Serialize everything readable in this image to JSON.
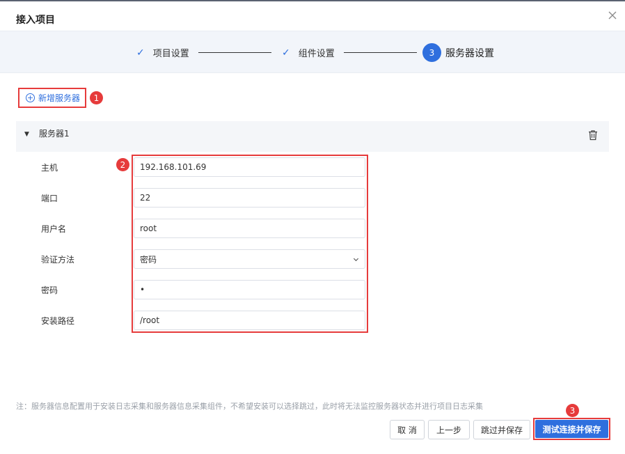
{
  "dialog": {
    "title": "接入项目",
    "close_icon": "close-icon"
  },
  "steps": [
    {
      "label": "项目设置",
      "state": "done"
    },
    {
      "label": "组件设置",
      "state": "done"
    },
    {
      "number": "3",
      "label": "服务器设置",
      "state": "active"
    }
  ],
  "add_server": {
    "label": "新增服务器",
    "badge": "1"
  },
  "server": {
    "name": "服务器1",
    "badge": "2"
  },
  "form": {
    "host": {
      "label": "主机",
      "value": "192.168.101.69"
    },
    "port": {
      "label": "端口",
      "value": "22"
    },
    "username": {
      "label": "用户名",
      "value": "root"
    },
    "auth_method": {
      "label": "验证方法",
      "value": "密码"
    },
    "password": {
      "label": "密码",
      "value": "•"
    },
    "install_path": {
      "label": "安装路径",
      "value": "/root"
    }
  },
  "footer": {
    "note": "注：服务器信息配置用于安装日志采集和服务器信息采集组件，不希望安装可以选择跳过，此时将无法监控服务器状态并进行项目日志采集",
    "cancel_label": "取 消",
    "prev_label": "上一步",
    "skip_save_label": "跳过并保存",
    "test_save_label": "测试连接并保存",
    "badge": "3"
  },
  "colors": {
    "primary": "#2f6fde",
    "highlight": "#e63b3b",
    "step_bar_bg": "#f2f5fa"
  }
}
